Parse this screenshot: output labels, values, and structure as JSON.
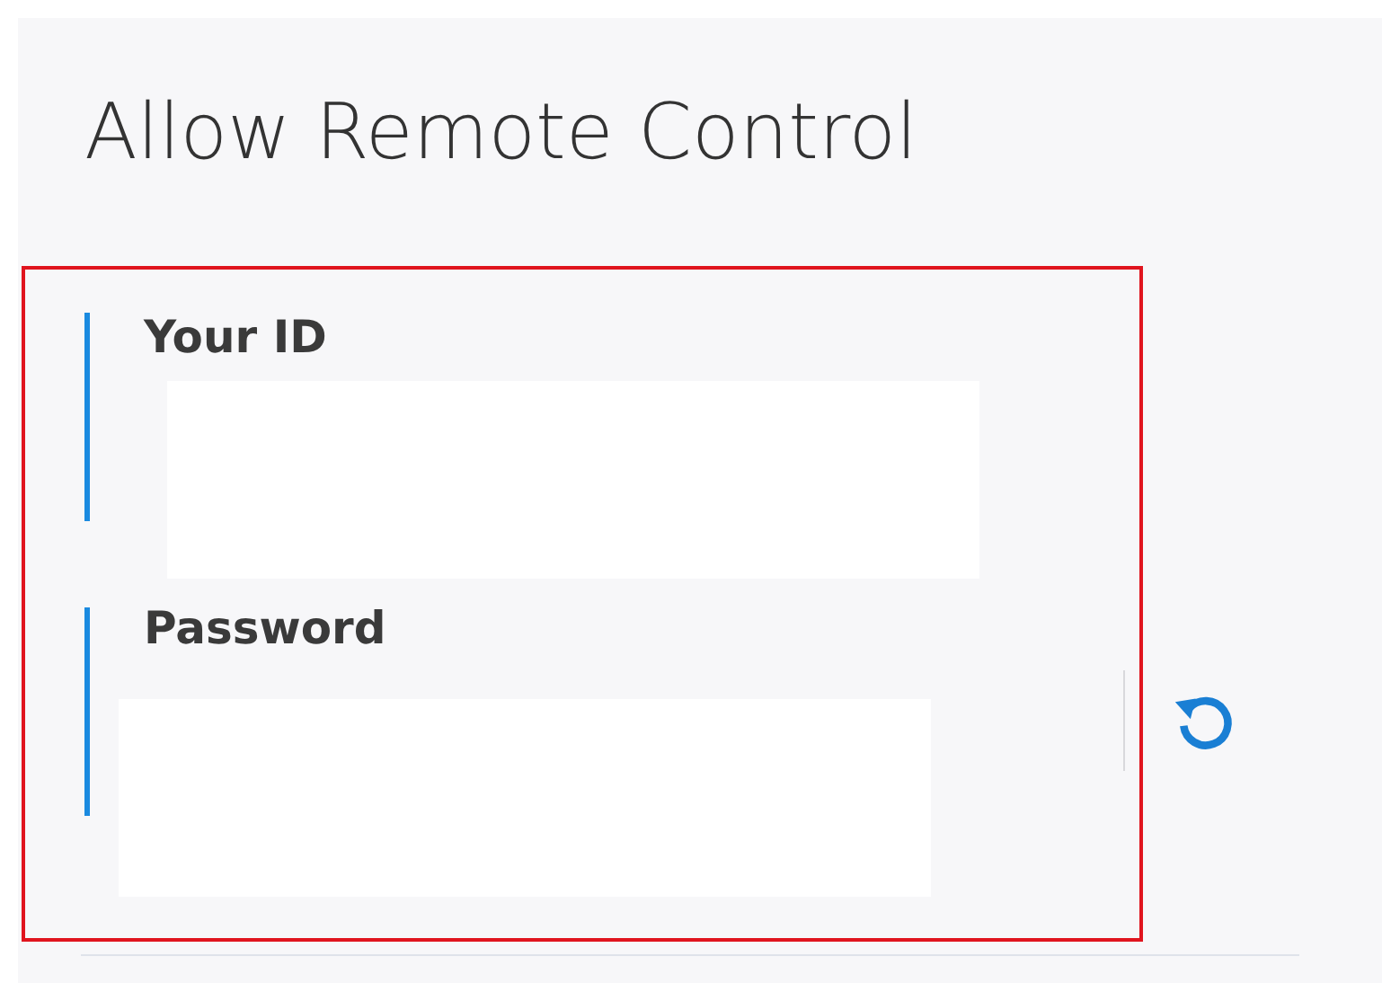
{
  "title": "Allow Remote Control",
  "fields": [
    {
      "label": "Your ID"
    },
    {
      "label": "Password"
    }
  ]
}
